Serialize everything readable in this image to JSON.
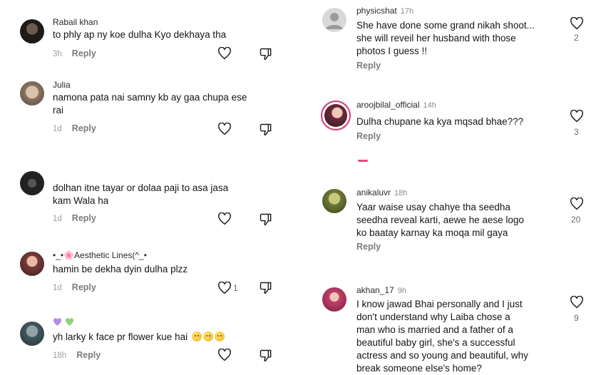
{
  "colors": {
    "text": "#161616",
    "muted": "#8d8d8d",
    "accent_ring": "#e0337a",
    "heart_purple": "#b48ae6",
    "heart_green": "#8fd07a"
  },
  "left_comments": [
    {
      "username": "Rabail khan",
      "text": "to phly ap ny koe dulha Kyo dekhaya tha",
      "time": "3h",
      "reply": "Reply",
      "likes": ""
    },
    {
      "username": "Julia",
      "text_lines": [
        "namona pata nai samny kb ay gaa chupa ese",
        "rai"
      ],
      "time": "1d",
      "reply": "Reply",
      "likes": ""
    },
    {
      "username": "",
      "text_lines": [
        "dolhan itne tayar or dolaa paji to asa jasa",
        "kam Wala ha"
      ],
      "time": "1d",
      "reply": "Reply",
      "likes": ""
    },
    {
      "username": "•_•🌸Aesthetic Lines(^_•",
      "text": "hamin be dekha dyin dulha plzz",
      "time": "1d",
      "reply": "Reply",
      "likes": "1"
    },
    {
      "username": "",
      "text": "yh larky k face pr flower kue hai",
      "time": "18h",
      "reply": "Reply",
      "likes": ""
    }
  ],
  "right_comments": [
    {
      "username": "physicshat",
      "time": "17h",
      "text_lines": [
        "She have done some grand nikah shoot...",
        "she will reveil her husband with those",
        "photos I guess !!"
      ],
      "reply": "Reply",
      "likes": "2"
    },
    {
      "username": "aroojbilal_official",
      "time": "14h",
      "text": "Dulha chupane ka kya mqsad bhae???",
      "reply": "Reply",
      "likes": "3"
    },
    {
      "username": "anikaluvr",
      "time": "18h",
      "text_lines": [
        "Yaar waise usay chahye tha seedha",
        "seedha reveal karti, aewe he aese logo",
        "ko baatay karnay ka moqa mil gaya"
      ],
      "reply": "Reply",
      "likes": "20"
    },
    {
      "username": "akhan_17",
      "time": "9h",
      "text_lines": [
        "I know jawad Bhai personally and I just",
        "don't understand why Laiba chose a",
        "man who is married and a father of a",
        "beautiful baby girl, she's a successful",
        "actress and so young and beautiful, why",
        "break someone else's home?"
      ],
      "reply": "",
      "likes": "9"
    }
  ]
}
